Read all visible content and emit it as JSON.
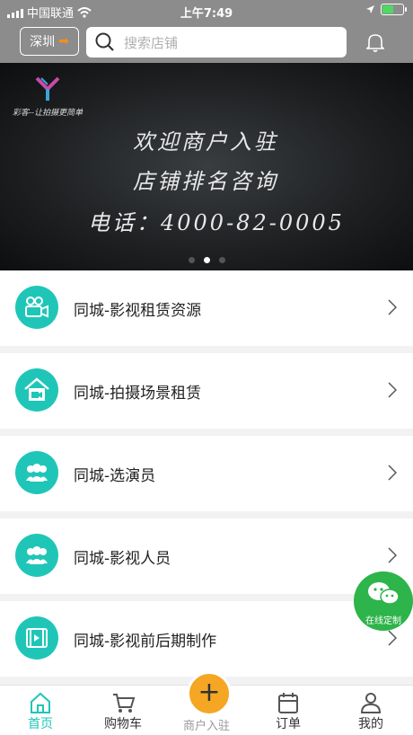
{
  "status_bar": {
    "carrier": "中国联通",
    "time": "上午7:49"
  },
  "header": {
    "city": "深圳",
    "search_placeholder": "搜索店铺"
  },
  "banner": {
    "tagline": "彩客--让拍摄更简单",
    "line1": "欢迎商户入驻",
    "line2": "店铺排名咨询",
    "line3": "电话：4000-82-0005",
    "active_dot": 1
  },
  "categories": [
    {
      "label": "同城-影视租赁资源",
      "icon": "camera-icon"
    },
    {
      "label": "同城-拍摄场景租赁",
      "icon": "house-camera-icon"
    },
    {
      "label": "同城-选演员",
      "icon": "people-icon"
    },
    {
      "label": "同城-影视人员",
      "icon": "people-icon"
    },
    {
      "label": "同城-影视前后期制作",
      "icon": "film-icon"
    }
  ],
  "floating": {
    "wechat_label": "在线定制"
  },
  "tabbar": {
    "home": "首页",
    "cart": "购物车",
    "merchant": "商户入驻",
    "orders": "订单",
    "mine": "我的"
  },
  "colors": {
    "accent": "#1fc6b8",
    "header": "#8c8c8c",
    "plus": "#f5a623",
    "wechat": "#2db44a"
  }
}
